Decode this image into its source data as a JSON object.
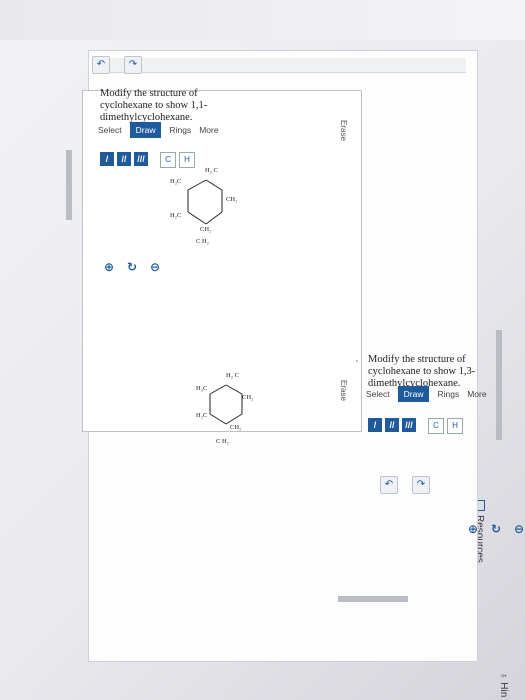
{
  "header": {
    "resources_label": "Resources",
    "hint_label": "Hin"
  },
  "panels": [
    {
      "prompt": "Modify the structure of cyclohexane to show 1,1-dimethylcyclohexane.",
      "tabs": {
        "select": "Select",
        "draw": "Draw",
        "rings": "Rings",
        "more": "More"
      },
      "erase": "Erase",
      "bonds": [
        "/",
        "//",
        "///"
      ],
      "atoms": [
        "C",
        "H"
      ],
      "toolbar": {
        "undo": "↶",
        "redo": "↷"
      },
      "zoom": {
        "zoom_in": "⊕",
        "reset": "↻",
        "zoom_out": "⊖"
      },
      "molecule": {
        "top": "H₂\nC",
        "left_top": "H₂C",
        "left_bottom": "H₂C",
        "bottom": "C\nH₂",
        "right_top": "CH₂",
        "right_bottom": "CH₂"
      }
    },
    {
      "prompt": "Modify the structure of cyclohexane to show 1,3-dimethylcyclohexane.",
      "tabs": {
        "select": "Select",
        "draw": "Draw",
        "rings": "Rings",
        "more": "More"
      },
      "erase": "Erase",
      "bonds": [
        "/",
        "//",
        "///"
      ],
      "atoms": [
        "C",
        "H"
      ],
      "toolbar": {
        "undo": "↶",
        "redo": "↷"
      },
      "zoom": {
        "zoom_in": "⊕",
        "reset": "↻",
        "zoom_out": "⊖"
      },
      "molecule": {
        "top": "H₂\nC",
        "left_top": "H₂C",
        "left_bottom": "H₂C",
        "bottom": "C\nH₂",
        "right_top": "CH₂",
        "right_bottom": "CH₂"
      }
    }
  ]
}
